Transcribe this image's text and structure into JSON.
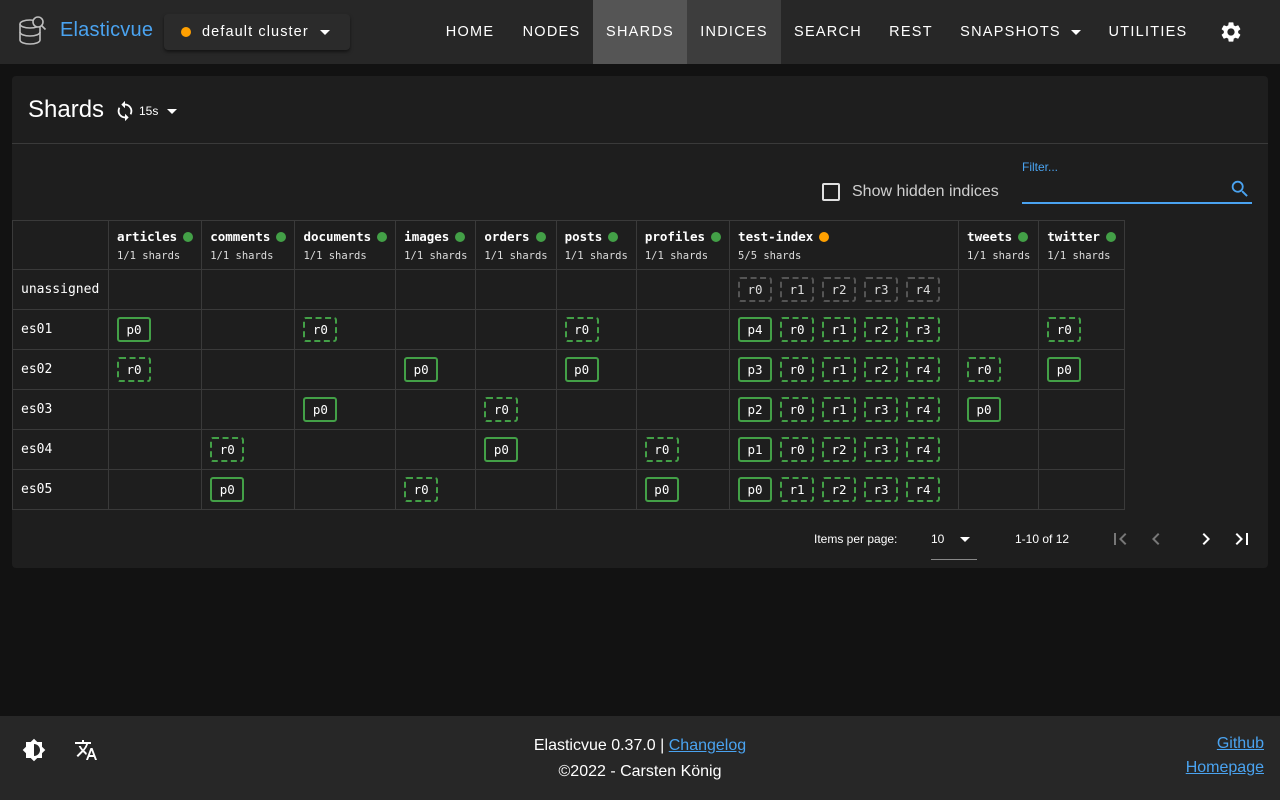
{
  "app": {
    "title": "Elasticvue"
  },
  "cluster": {
    "label": "default cluster",
    "status_color": "#ffa000"
  },
  "nav": [
    {
      "label": "HOME"
    },
    {
      "label": "NODES"
    },
    {
      "label": "SHARDS"
    },
    {
      "label": "INDICES"
    },
    {
      "label": "SEARCH"
    },
    {
      "label": "REST"
    },
    {
      "label": "SNAPSHOTS"
    },
    {
      "label": "UTILITIES"
    }
  ],
  "page": {
    "title": "Shards",
    "refresh_interval": "15s"
  },
  "filters": {
    "show_hidden_label": "Show hidden indices",
    "filter_label": "Filter...",
    "filter_value": ""
  },
  "colors": {
    "green": "#43a047",
    "yellow": "#ffa000",
    "accent": "#4aa3f0"
  },
  "indices": [
    {
      "name": "articles",
      "shards": "1/1 shards",
      "health": "green"
    },
    {
      "name": "comments",
      "shards": "1/1 shards",
      "health": "green"
    },
    {
      "name": "documents",
      "shards": "1/1 shards",
      "health": "green"
    },
    {
      "name": "images",
      "shards": "1/1 shards",
      "health": "green"
    },
    {
      "name": "orders",
      "shards": "1/1 shards",
      "health": "green"
    },
    {
      "name": "posts",
      "shards": "1/1 shards",
      "health": "green"
    },
    {
      "name": "profiles",
      "shards": "1/1 shards",
      "health": "green"
    },
    {
      "name": "test-index",
      "shards": "5/5 shards",
      "health": "yellow"
    },
    {
      "name": "tweets",
      "shards": "1/1 shards",
      "health": "green"
    },
    {
      "name": "twitter",
      "shards": "1/1 shards",
      "health": "green"
    }
  ],
  "rows": [
    {
      "node": "unassigned",
      "cells": [
        [],
        [],
        [],
        [],
        [],
        [],
        [],
        [
          {
            "t": "u",
            "l": "r0"
          },
          {
            "t": "u",
            "l": "r1"
          },
          {
            "t": "u",
            "l": "r2"
          },
          {
            "t": "u",
            "l": "r3"
          },
          {
            "t": "u",
            "l": "r4"
          }
        ],
        [],
        []
      ]
    },
    {
      "node": "es01",
      "cells": [
        [
          {
            "t": "p",
            "l": "p0"
          }
        ],
        [],
        [
          {
            "t": "r",
            "l": "r0"
          }
        ],
        [],
        [],
        [
          {
            "t": "r",
            "l": "r0"
          }
        ],
        [],
        [
          {
            "t": "p",
            "l": "p4"
          },
          {
            "t": "r",
            "l": "r0"
          },
          {
            "t": "r",
            "l": "r1"
          },
          {
            "t": "r",
            "l": "r2"
          },
          {
            "t": "r",
            "l": "r3"
          }
        ],
        [],
        [
          {
            "t": "r",
            "l": "r0"
          }
        ]
      ]
    },
    {
      "node": "es02",
      "cells": [
        [
          {
            "t": "r",
            "l": "r0"
          }
        ],
        [],
        [],
        [
          {
            "t": "p",
            "l": "p0"
          }
        ],
        [],
        [
          {
            "t": "p",
            "l": "p0"
          }
        ],
        [],
        [
          {
            "t": "p",
            "l": "p3"
          },
          {
            "t": "r",
            "l": "r0"
          },
          {
            "t": "r",
            "l": "r1"
          },
          {
            "t": "r",
            "l": "r2"
          },
          {
            "t": "r",
            "l": "r4"
          }
        ],
        [
          {
            "t": "r",
            "l": "r0"
          }
        ],
        [
          {
            "t": "p",
            "l": "p0"
          }
        ]
      ]
    },
    {
      "node": "es03",
      "cells": [
        [],
        [],
        [
          {
            "t": "p",
            "l": "p0"
          }
        ],
        [],
        [
          {
            "t": "r",
            "l": "r0"
          }
        ],
        [],
        [],
        [
          {
            "t": "p",
            "l": "p2"
          },
          {
            "t": "r",
            "l": "r0"
          },
          {
            "t": "r",
            "l": "r1"
          },
          {
            "t": "r",
            "l": "r3"
          },
          {
            "t": "r",
            "l": "r4"
          }
        ],
        [
          {
            "t": "p",
            "l": "p0"
          }
        ],
        []
      ]
    },
    {
      "node": "es04",
      "cells": [
        [],
        [
          {
            "t": "r",
            "l": "r0"
          }
        ],
        [],
        [],
        [
          {
            "t": "p",
            "l": "p0"
          }
        ],
        [],
        [
          {
            "t": "r",
            "l": "r0"
          }
        ],
        [
          {
            "t": "p",
            "l": "p1"
          },
          {
            "t": "r",
            "l": "r0"
          },
          {
            "t": "r",
            "l": "r2"
          },
          {
            "t": "r",
            "l": "r3"
          },
          {
            "t": "r",
            "l": "r4"
          }
        ],
        [],
        []
      ]
    },
    {
      "node": "es05",
      "cells": [
        [],
        [
          {
            "t": "p",
            "l": "p0"
          }
        ],
        [],
        [
          {
            "t": "r",
            "l": "r0"
          }
        ],
        [],
        [],
        [
          {
            "t": "p",
            "l": "p0"
          }
        ],
        [
          {
            "t": "p",
            "l": "p0"
          },
          {
            "t": "r",
            "l": "r1"
          },
          {
            "t": "r",
            "l": "r2"
          },
          {
            "t": "r",
            "l": "r3"
          },
          {
            "t": "r",
            "l": "r4"
          }
        ],
        [],
        []
      ]
    }
  ],
  "pagination": {
    "items_per_page_label": "Items per page:",
    "items_per_page": "10",
    "range": "1-10 of 12"
  },
  "footer": {
    "version": "Elasticvue 0.37.0 |",
    "changelog": "Changelog",
    "copyright": "©2022 - Carsten König",
    "github": "Github",
    "homepage": "Homepage"
  }
}
